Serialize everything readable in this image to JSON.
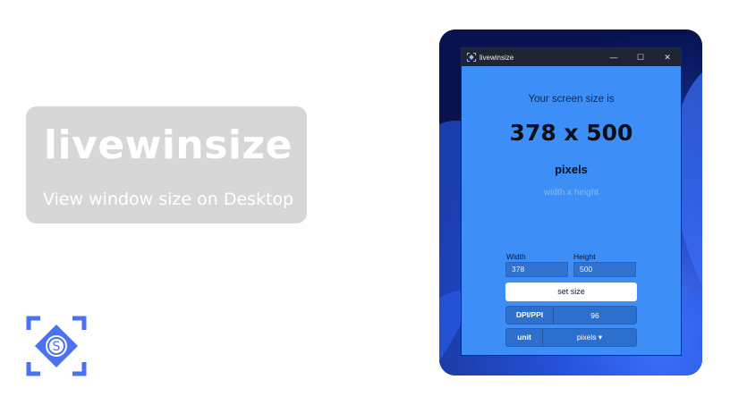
{
  "promo": {
    "title": "livewinsize",
    "subtitle": "View window size on Desktop"
  },
  "window": {
    "title": "livewinsize",
    "controls": {
      "minimize": "—",
      "maximize": "☐",
      "close": "✕"
    }
  },
  "display": {
    "lead": "Your screen size is",
    "dimensions": "378 x 500",
    "unit": "pixels",
    "caption": "width x height"
  },
  "form": {
    "width_label": "Width",
    "height_label": "Height",
    "width_value": "378",
    "height_value": "500",
    "set_size_label": "set size",
    "dpi_label": "DPI/PPI",
    "dpi_value": "96",
    "unit_label": "unit",
    "unit_value": "pixels ▾"
  },
  "colors": {
    "accent": "#3d8ef6",
    "logo": "#4a72f2"
  }
}
